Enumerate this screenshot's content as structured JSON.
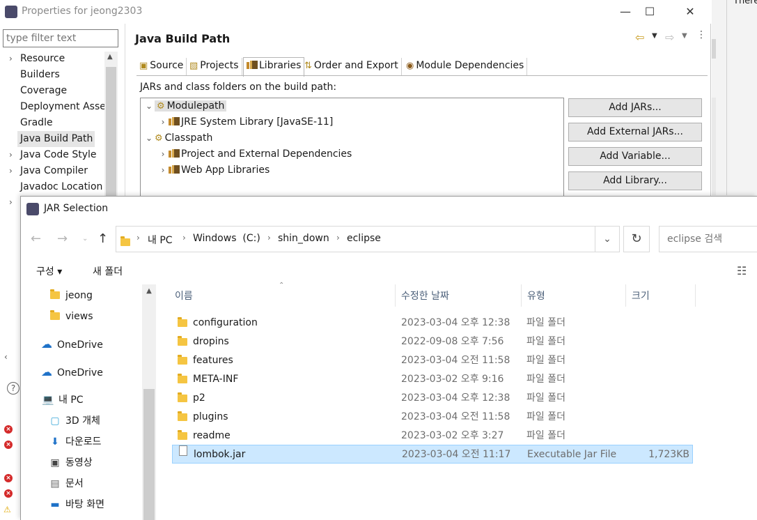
{
  "properties": {
    "title": "Properties for jeong2303",
    "filter_placeholder": "type filter text",
    "nav_items": [
      "Resource",
      "Builders",
      "Coverage",
      "Deployment Asse",
      "Gradle",
      "Java Build Path",
      "Java Code Style",
      "Java Compiler",
      "Javadoc Location"
    ],
    "selected_nav": "Java Build Path",
    "page_title": "Java Build Path",
    "tabs": [
      "Source",
      "Projects",
      "Libraries",
      "Order and Export",
      "Module Dependencies"
    ],
    "active_tab": "Libraries",
    "build_desc": "JARs and class folders on the build path:",
    "tree": [
      {
        "label": "Modulepath",
        "level": 0,
        "expanded": true
      },
      {
        "label": "JRE System Library [JavaSE-11]",
        "level": 1,
        "expanded": false
      },
      {
        "label": "Classpath",
        "level": 0,
        "expanded": true
      },
      {
        "label": "Project and External Dependencies",
        "level": 1,
        "expanded": false
      },
      {
        "label": "Web App Libraries",
        "level": 1,
        "expanded": false
      }
    ],
    "buttons": [
      "Add JARs...",
      "Add External JARs...",
      "Add Variable...",
      "Add Library..."
    ],
    "right_text": "There"
  },
  "jar_dialog": {
    "title": "JAR Selection",
    "breadcrumbs": [
      "내 PC",
      "Windows  (C:)",
      "shin_down",
      "eclipse"
    ],
    "search_placeholder": "eclipse 검색",
    "organize": "구성 ▾",
    "new_folder": "새 폴더",
    "left_nav": [
      {
        "label": "jeong",
        "icon": "folder-icon"
      },
      {
        "label": "views",
        "icon": "folder-icon"
      },
      {
        "label": "OneDrive",
        "icon": "cloud-icon"
      },
      {
        "label": "OneDrive",
        "icon": "cloud-icon"
      },
      {
        "label": "내 PC",
        "icon": "computer-icon"
      },
      {
        "label": "3D 개체",
        "icon": "cube-icon"
      },
      {
        "label": "다운로드",
        "icon": "download-icon"
      },
      {
        "label": "동영상",
        "icon": "video-icon"
      },
      {
        "label": "문서",
        "icon": "document-icon"
      },
      {
        "label": "바탕 화면",
        "icon": "desktop-icon"
      }
    ],
    "columns": [
      "이름",
      "수정한 날짜",
      "유형",
      "크기"
    ],
    "files": [
      {
        "name": "configuration",
        "date": "2023-03-04 오후 12:38",
        "type": "파일 폴더",
        "size": ""
      },
      {
        "name": "dropins",
        "date": "2022-09-08 오후 7:56",
        "type": "파일 폴더",
        "size": ""
      },
      {
        "name": "features",
        "date": "2023-03-04 오전 11:58",
        "type": "파일 폴더",
        "size": ""
      },
      {
        "name": "META-INF",
        "date": "2023-03-02 오후 9:16",
        "type": "파일 폴더",
        "size": ""
      },
      {
        "name": "p2",
        "date": "2023-03-04 오후 12:38",
        "type": "파일 폴더",
        "size": ""
      },
      {
        "name": "plugins",
        "date": "2023-03-04 오전 11:58",
        "type": "파일 폴더",
        "size": ""
      },
      {
        "name": "readme",
        "date": "2023-03-02 오후 3:27",
        "type": "파일 폴더",
        "size": ""
      },
      {
        "name": "lombok.jar",
        "date": "2023-03-04 오전 11:17",
        "type": "Executable Jar File",
        "size": "1,723KB"
      }
    ],
    "selected_file": "lombok.jar"
  }
}
